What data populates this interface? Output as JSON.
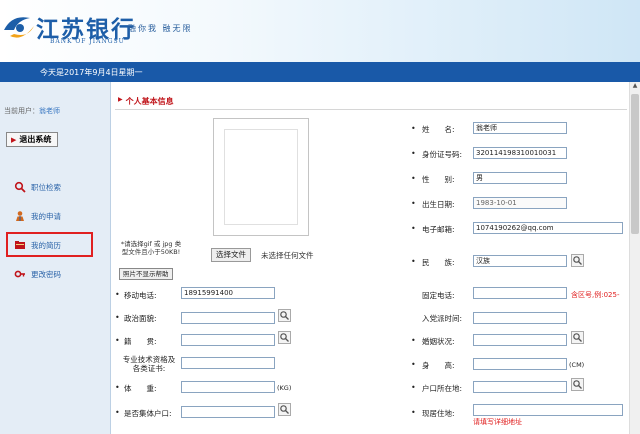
{
  "header": {
    "logo_cn": "江苏银行",
    "logo_en": "BANK OF JIANGSU",
    "slogan": "融你我 融无限"
  },
  "datebar": {
    "text": "今天是2017年9月4日星期一"
  },
  "sidebar": {
    "user_prefix": "当前用户：",
    "user_name": "翁老师",
    "logout_label": "退出系统",
    "items": [
      {
        "label": "职位检索",
        "icon": "search-icon"
      },
      {
        "label": "我的申请",
        "icon": "person-icon"
      },
      {
        "label": "我的简历",
        "icon": "folder-icon"
      },
      {
        "label": "更改密码",
        "icon": "key-icon"
      }
    ]
  },
  "form": {
    "section_title": "个人基本信息",
    "photo_tip": "*请选择gif 或 jpg 类型文件且小于50KB!",
    "choose_file": "选择文件",
    "no_file": "未选择任何文件",
    "photo_help": "照片不显示帮助",
    "name_label": "姓　　名:",
    "name_value": "翁老师",
    "id_label": "身份证号码:",
    "id_value": "320114198310010031",
    "gender_label": "性　　别:",
    "gender_value": "男",
    "birth_label": "出生日期:",
    "birth_value": "1983-10-01",
    "email_label": "电子邮箱:",
    "email_value": "1074190262@qq.com",
    "nation_label": "民　　族:",
    "nation_value": "汉族",
    "mobile_label": "移动电话:",
    "mobile_value": "18915991400",
    "phone_label": "固定电话:",
    "phone_hint": "含区号,例:025-",
    "political_label": "政治面貌:",
    "party_date_label": "入党派时间:",
    "origin_label": "籍　　贯:",
    "marital_label": "婚姻状况:",
    "cert_label": "专业技术资格及各类证书:",
    "height_label": "身　　高:",
    "height_unit": "(CM)",
    "weight_label": "体　　重:",
    "weight_unit": "(KG)",
    "hukou_label": "户口所在地:",
    "collective_label": "是否集体户口:",
    "address_label": "现居住地:",
    "address_hint": "请填写详细地址"
  }
}
